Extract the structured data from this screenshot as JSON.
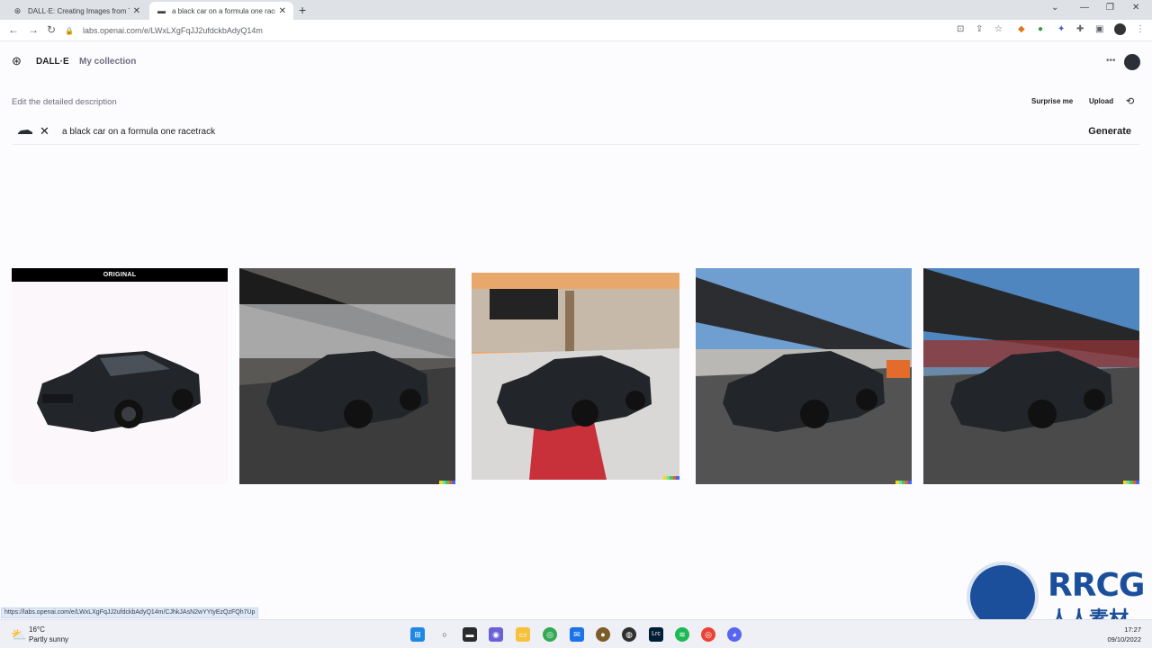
{
  "browser": {
    "tabs": [
      {
        "title": "DALL·E: Creating Images from Te",
        "active": false
      },
      {
        "title": "a black car on a formula one race",
        "active": true
      }
    ],
    "url": "labs.openai.com/e/LWxLXgFqJJ2ufdckbAdyQ14m",
    "status_url": "https://labs.openai.com/e/LWxLXgFqJJ2ufdckbAdyQ14m/CJhkJAsN2wYYtyEzQzFQh7Up"
  },
  "app": {
    "brand": "DALL·E",
    "nav_collection": "My collection"
  },
  "editor": {
    "label": "Edit the detailed description",
    "surprise": "Surprise me",
    "upload": "Upload",
    "prompt": "a black car on a formula one racetrack",
    "generate": "Generate"
  },
  "results": {
    "original_label": "ORIGINAL"
  },
  "taskbar": {
    "temp": "16°C",
    "weather": "Partly sunny",
    "time": "17:27",
    "date": "09/10/2022",
    "apps": [
      "windows-start",
      "search",
      "task-view",
      "chat",
      "file-explorer",
      "chrome",
      "mail",
      "paint",
      "obs",
      "lightroom",
      "spotify",
      "chrome-active",
      "discord"
    ]
  },
  "watermark": {
    "text1": "RRCG",
    "text2": "人人素材"
  },
  "colors": {
    "accent": "#202123",
    "muted": "#6e6e80",
    "taskbar_bg": "#eef0f6"
  }
}
